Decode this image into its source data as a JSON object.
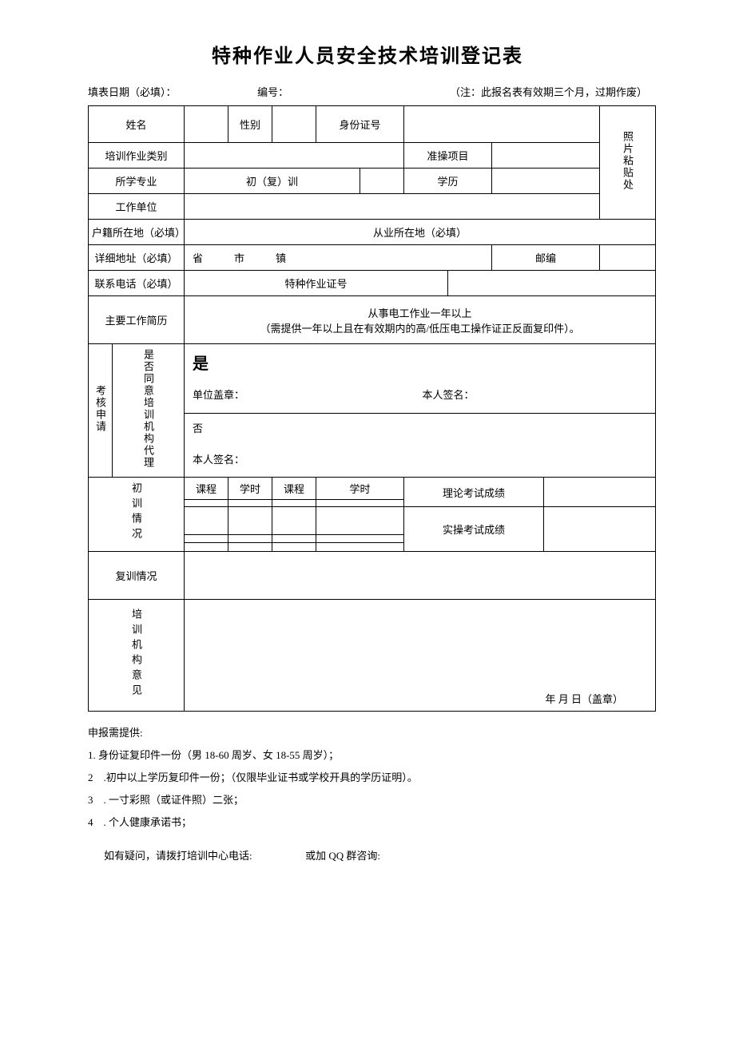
{
  "title": "特种作业人员安全技术培训登记表",
  "header": {
    "fillDateLabel": "填表日期（必填）：",
    "serialLabel": "编号：",
    "note": "（注：此报名表有效期三个月，过期作废）"
  },
  "rows": {
    "name": "姓名",
    "gender": "性别",
    "idno": "身份证号",
    "photo": "照片粘贴处",
    "trainCategory": "培训作业类别",
    "approvedItem": "准操项目",
    "major": "所学专业",
    "trainType": "初（复）训",
    "education": "学历",
    "workUnit": "工作单位",
    "registeredPlace": "户籍所在地（必填）",
    "workPlace": "从业所在地（必填）",
    "address": "详细地址（必填）",
    "addressFields": "省　　　市　　　镇",
    "postcode": "邮编",
    "phone": "联系电话（必填）",
    "certNo": "特种作业证号",
    "workHistory": "主要工作简历",
    "workHistoryContent1": "从事电工作业一年以上",
    "workHistoryContent2": "（需提供一年以上且在有效期内的高/低压电工操作证正反面复印件）。",
    "examApplyLabel": "考核申请",
    "agentLabel": "是否同意培训机构代理",
    "yes": "是",
    "no": "否",
    "unitSeal": "单位盖章：",
    "selfSign": "本人签名：",
    "initialTraining": "初训情况",
    "course": "课程",
    "hours": "学时",
    "theoryScore": "理论考试成绩",
    "practicalScore": "实操考试成绩",
    "retraining": "复训情况",
    "orgOpinion": "培训机构意见",
    "dateSeal": "年 月 日（盖章）"
  },
  "footer": {
    "heading": "申报需提供:",
    "item1": "1. 身份证复印件一份（男 18-60 周岁、女 18-55 周岁）；",
    "item2": "2　.初中以上学历复印件一份；（仅限毕业证书或学校开具的学历证明）。",
    "item3": "3　. 一寸彩照（或证件照）二张；",
    "item4": "4　. 个人健康承诺书；",
    "contact1": "如有疑问，请拨打培训中心电话:",
    "contact2": "或加 QQ 群咨询:"
  }
}
